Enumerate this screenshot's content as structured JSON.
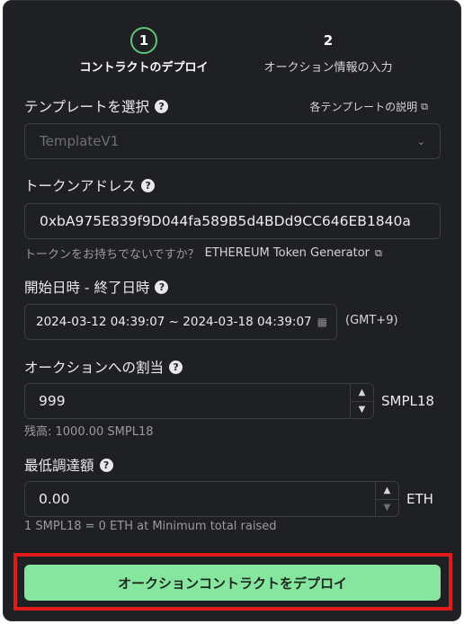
{
  "stepper": {
    "steps": [
      {
        "number": "1",
        "label": "コントラクトのデプロイ",
        "active": true
      },
      {
        "number": "2",
        "label": "オークション情報の入力",
        "active": false
      }
    ]
  },
  "template": {
    "label": "テンプレートを選択",
    "help_icon": "question-circle-icon",
    "docs_link": "各テンプレートの説明",
    "selected": "TemplateV1"
  },
  "token_address": {
    "label": "トークンアドレス",
    "value": "0xbA975E839f9D044fa589B5d4BDd9CC646EB1840a",
    "hint": "トークンをお持ちでないですか？",
    "generator_link": "ETHEREUM Token Generator"
  },
  "schedule": {
    "label": "開始日時 - 終了日時",
    "value": "2024-03-12 04:39:07 ~ 2024-03-18 04:39:07",
    "timezone": "(GMT+9)"
  },
  "allocation": {
    "label": "オークションへの割当",
    "value": "999",
    "unit": "SMPL18",
    "balance": "残高: 1000.00 SMPL18"
  },
  "minimum_raise": {
    "label": "最低調達額",
    "value": "0.00",
    "unit": "ETH",
    "rate": "1 SMPL18 = 0 ETH at Minimum total raised"
  },
  "deploy_button": "オークションコントラクトをデプロイ",
  "colors": {
    "background": "#1f2024",
    "accent": "#86e6a0",
    "step_ring": "#5fc47a",
    "highlight": "#e11a1a"
  }
}
